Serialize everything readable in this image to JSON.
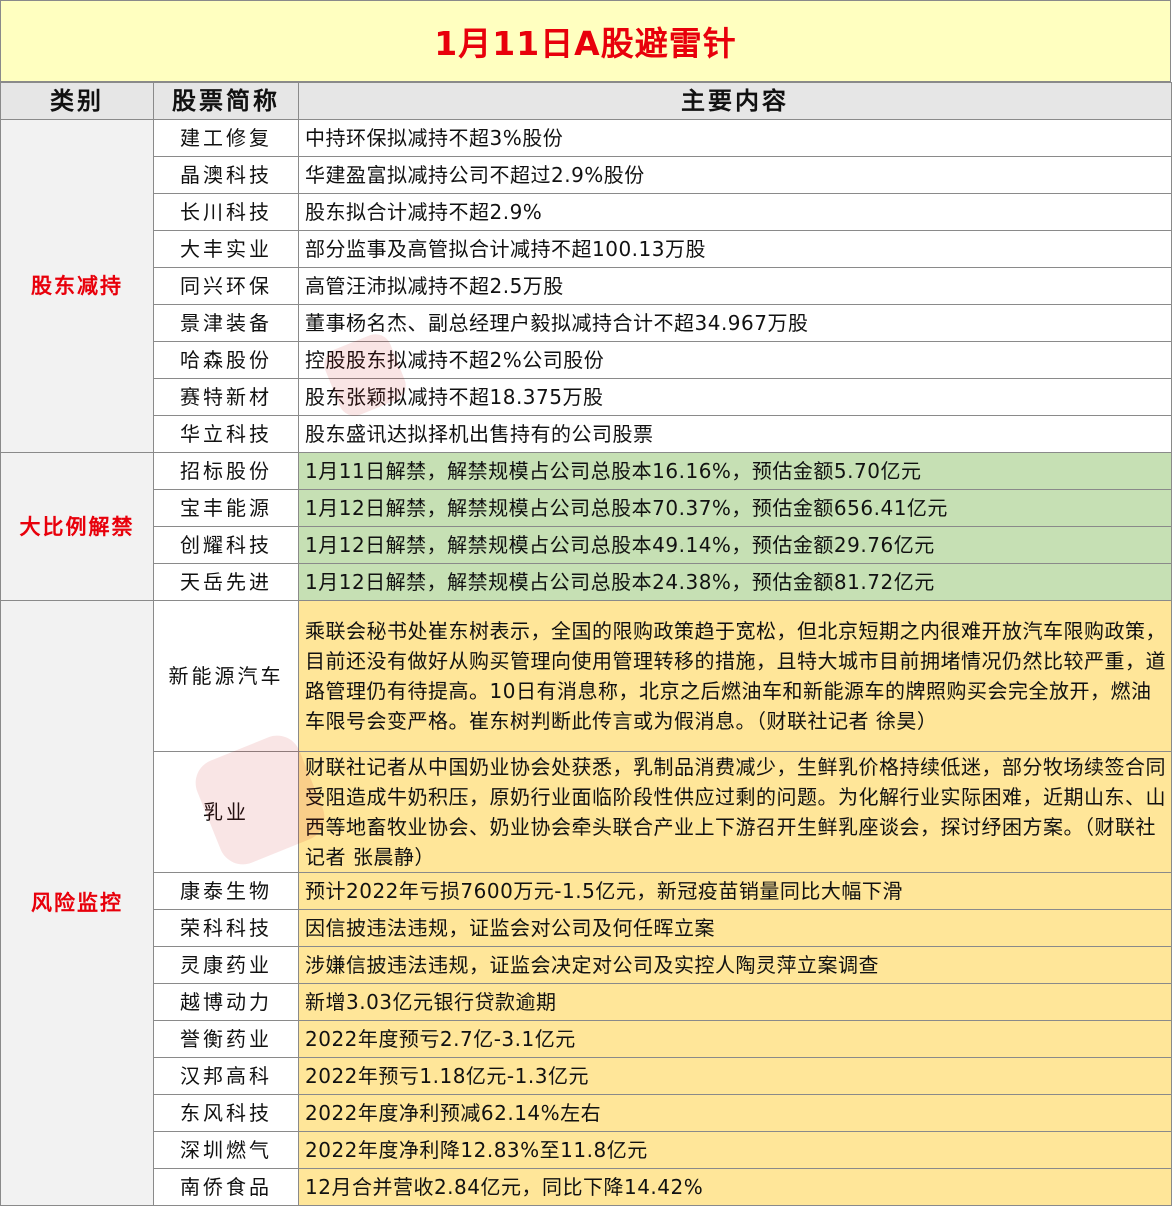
{
  "title": "1月11日A股避雷针",
  "headers": {
    "category": "类别",
    "stock": "股票简称",
    "content": "主要内容"
  },
  "groups": [
    {
      "category": "股东减持",
      "rows": [
        {
          "stock": "建工修复",
          "content": "中持环保拟减持不超3%股份"
        },
        {
          "stock": "晶澳科技",
          "content": "华建盈富拟减持公司不超过2.9%股份"
        },
        {
          "stock": "长川科技",
          "content": "股东拟合计减持不超2.9%"
        },
        {
          "stock": "大丰实业",
          "content": "部分监事及高管拟合计减持不超100.13万股"
        },
        {
          "stock": "同兴环保",
          "content": "高管汪沛拟减持不超2.5万股"
        },
        {
          "stock": "景津装备",
          "content": "董事杨名杰、副总经理户毅拟减持合计不超34.967万股"
        },
        {
          "stock": "哈森股份",
          "content": "控股股东拟减持不超2%公司股份"
        },
        {
          "stock": "赛特新材",
          "content": "股东张颖拟减持不超18.375万股"
        },
        {
          "stock": "华立科技",
          "content": "股东盛讯达拟择机出售持有的公司股票"
        }
      ]
    },
    {
      "category": "大比例解禁",
      "rows": [
        {
          "stock": "招标股份",
          "content": "1月11日解禁，解禁规模占公司总股本16.16%，预估金额5.70亿元"
        },
        {
          "stock": "宝丰能源",
          "content": "1月12日解禁，解禁规模占公司总股本70.37%，预估金额656.41亿元"
        },
        {
          "stock": "创耀科技",
          "content": "1月12日解禁，解禁规模占公司总股本49.14%，预估金额29.76亿元"
        },
        {
          "stock": "天岳先进",
          "content": "1月12日解禁，解禁规模占公司总股本24.38%，预估金额81.72亿元"
        }
      ]
    },
    {
      "category": "风险监控",
      "rows": [
        {
          "stock": "新能源汽车",
          "content": "乘联会秘书处崔东树表示，全国的限购政策趋于宽松，但北京短期之内很难开放汽车限购政策，目前还没有做好从购买管理向使用管理转移的措施，且特大城市目前拥堵情况仍然比较严重，道路管理仍有待提高。10日有消息称，北京之后燃油车和新能源车的牌照购买会完全放开，燃油车限号会变严格。崔东树判断此传言或为假消息。（财联社记者 徐昊）"
        },
        {
          "stock": "乳业",
          "content": "财联社记者从中国奶业协会处获悉，乳制品消费减少，生鲜乳价格持续低迷，部分牧场续签合同受阻造成牛奶积压，原奶行业面临阶段性供应过剩的问题。为化解行业实际困难，近期山东、山西等地畜牧业协会、奶业协会牵头联合产业上下游召开生鲜乳座谈会，探讨纾困方案。（财联社记者 张晨静）"
        },
        {
          "stock": "康泰生物",
          "content": "预计2022年亏损7600万元-1.5亿元，新冠疫苗销量同比大幅下滑"
        },
        {
          "stock": "荣科科技",
          "content": "因信披违法违规，证监会对公司及何任晖立案"
        },
        {
          "stock": "灵康药业",
          "content": "涉嫌信披违法违规，证监会决定对公司及实控人陶灵萍立案调查"
        },
        {
          "stock": "越博动力",
          "content": "新增3.03亿元银行贷款逾期"
        },
        {
          "stock": "誉衡药业",
          "content": "2022年度预亏2.7亿-3.1亿元"
        },
        {
          "stock": "汉邦高科",
          "content": "2022年预亏1.18亿元-1.3亿元"
        },
        {
          "stock": "东风科技",
          "content": "2022年度净利预减62.14%左右"
        },
        {
          "stock": "深圳燃气",
          "content": "2022年度净利降12.83%至11.8亿元"
        },
        {
          "stock": "南侨食品",
          "content": "12月合并营收2.84亿元，同比下降14.42%"
        }
      ]
    }
  ],
  "colors": {
    "title_bg": "#ffffc0",
    "title_text": "#e8000b",
    "header_bg": "#e6e6e6",
    "category_bg": "#f2f2f2",
    "unlock_bg": "#c6e0b4",
    "risk_bg": "#ffe699"
  }
}
